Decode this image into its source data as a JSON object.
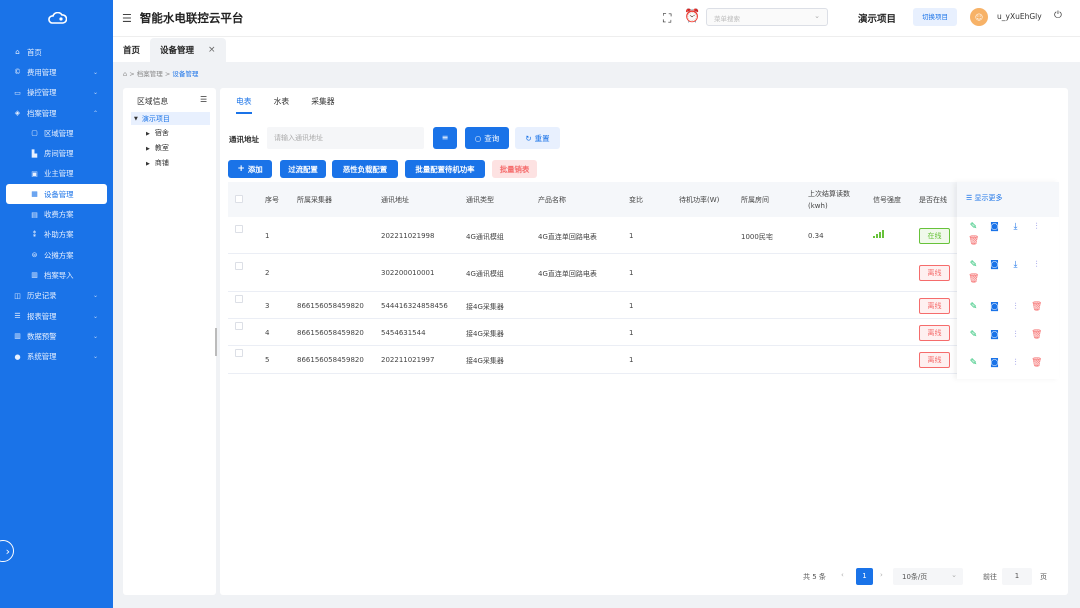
{
  "header": {
    "app_title": "智能水电联控云平台",
    "search_placeholder": "菜单搜索",
    "project_name": "演示项目",
    "switch_label": "切换项目",
    "username": "u_yXuEhGly"
  },
  "sidebar": {
    "items": [
      {
        "label": "首页",
        "icon": "home-icon",
        "level": 0
      },
      {
        "label": "费用管理",
        "icon": "coin-icon",
        "level": 0,
        "chevron": "down"
      },
      {
        "label": "操控管理",
        "icon": "monitor-icon",
        "level": 0,
        "chevron": "down"
      },
      {
        "label": "档案管理",
        "icon": "archive-icon",
        "level": 0,
        "chevron": "up"
      },
      {
        "label": "区域管理",
        "icon": "region-icon",
        "level": 1
      },
      {
        "label": "房间管理",
        "icon": "room-icon",
        "level": 1
      },
      {
        "label": "业主管理",
        "icon": "owner-icon",
        "level": 1
      },
      {
        "label": "设备管理",
        "icon": "device-icon",
        "level": 1,
        "active": true
      },
      {
        "label": "收费方案",
        "icon": "fee-icon",
        "level": 1
      },
      {
        "label": "补助方案",
        "icon": "subsidy-icon",
        "level": 1
      },
      {
        "label": "公摊方案",
        "icon": "share-icon",
        "level": 1
      },
      {
        "label": "档案导入",
        "icon": "import-icon",
        "level": 1
      },
      {
        "label": "历史记录",
        "icon": "history-icon",
        "level": 0,
        "chevron": "down"
      },
      {
        "label": "报表管理",
        "icon": "report-icon",
        "level": 0,
        "chevron": "down"
      },
      {
        "label": "数据预警",
        "icon": "warning-icon",
        "level": 0,
        "chevron": "down"
      },
      {
        "label": "系统管理",
        "icon": "user-icon",
        "level": 0,
        "chevron": "down"
      }
    ]
  },
  "page_tabs": [
    {
      "label": "首页"
    },
    {
      "label": "设备管理",
      "closable": true
    }
  ],
  "breadcrumb": {
    "home": "⌂",
    "sep": ">",
    "parent": "档案管理",
    "current": "设备管理"
  },
  "tree": {
    "title": "区域信息",
    "root": "演示项目",
    "children": [
      "宿舍",
      "教室",
      "商铺"
    ]
  },
  "sub_tabs": [
    "电表",
    "水表",
    "采集器"
  ],
  "search": {
    "label": "通讯地址",
    "placeholder": "请输入通讯地址",
    "query_label": "查询",
    "reset_label": "重置"
  },
  "actions": {
    "add": "添加",
    "overcurrent": "过流配置",
    "malicious_load": "恶性负载配置",
    "batch_standby": "批量配置待机功率",
    "batch_cancel": "批量销表"
  },
  "table": {
    "headers": [
      "序号",
      "所属采集器",
      "通讯地址",
      "通讯类型",
      "产品名称",
      "变比",
      "待机功率(W)",
      "所属房间",
      "上次结算读数",
      "(kwh)",
      "信号强度",
      "是否在线"
    ],
    "show_more": "显示更多",
    "rows": [
      {
        "idx": "1",
        "collector": "",
        "addr": "202211021998",
        "type": "4G通讯模组",
        "product": "4G直连单回路电表",
        "ratio": "1",
        "standby": "",
        "room": "1000民宅",
        "reading": "0.34",
        "signal_level": 4,
        "online": "在线",
        "is_online": true,
        "ops": [
          "edit",
          "cfg",
          "dl",
          "tune",
          "del"
        ]
      },
      {
        "idx": "2",
        "collector": "",
        "addr": "302200010001",
        "type": "4G通讯模组",
        "product": "4G直连单回路电表",
        "ratio": "1",
        "standby": "",
        "room": "",
        "reading": "",
        "signal_level": 0,
        "online": "离线",
        "is_online": false,
        "ops": [
          "edit",
          "cfg",
          "dl",
          "tune",
          "del"
        ]
      },
      {
        "idx": "3",
        "collector": "866156058459820",
        "addr": "544416324858456",
        "type": "接4G采集器",
        "product": "",
        "ratio": "1",
        "standby": "",
        "room": "",
        "reading": "",
        "signal_level": 0,
        "online": "离线",
        "is_online": false,
        "ops": [
          "edit",
          "cfg",
          "tune",
          "del"
        ]
      },
      {
        "idx": "4",
        "collector": "866156058459820",
        "addr": "5454631544",
        "type": "接4G采集器",
        "product": "",
        "ratio": "1",
        "standby": "",
        "room": "",
        "reading": "",
        "signal_level": 0,
        "online": "离线",
        "is_online": false,
        "ops": [
          "edit",
          "cfg",
          "tune",
          "del"
        ]
      },
      {
        "idx": "5",
        "collector": "866156058459820",
        "addr": "202211021997",
        "type": "接4G采集器",
        "product": "",
        "ratio": "1",
        "standby": "",
        "room": "",
        "reading": "",
        "signal_level": 0,
        "online": "离线",
        "is_online": false,
        "ops": [
          "edit",
          "cfg",
          "tune",
          "del"
        ]
      }
    ]
  },
  "pagination": {
    "total": "共 5 条",
    "current_page": "1",
    "page_size": "10条/页",
    "goto_label": "前往",
    "goto_value": "1",
    "page_suffix": "页"
  },
  "colors": {
    "primary": "#1a73e8",
    "online": "#67c23a",
    "offline": "#f56c6c"
  }
}
